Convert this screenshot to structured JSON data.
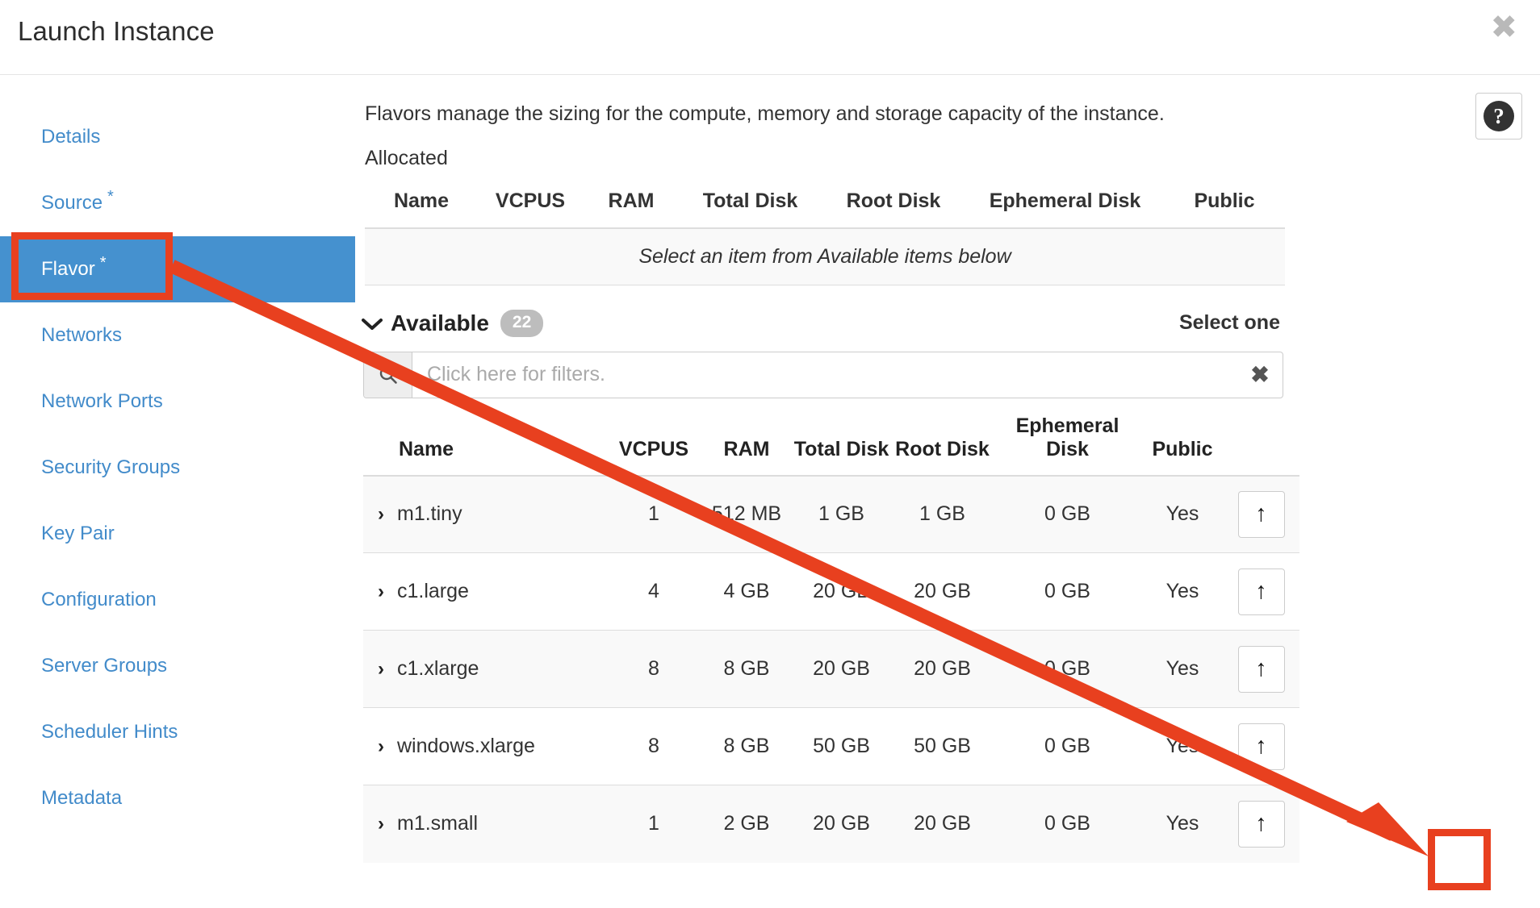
{
  "modal": {
    "title": "Launch Instance",
    "close_label": "✖"
  },
  "sidebar": {
    "items": [
      {
        "label": "Details",
        "required": "",
        "active": false
      },
      {
        "label": "Source",
        "required": "*",
        "active": false
      },
      {
        "label": "Flavor",
        "required": "*",
        "active": true
      },
      {
        "label": "Networks",
        "required": "",
        "active": false
      },
      {
        "label": "Network Ports",
        "required": "",
        "active": false
      },
      {
        "label": "Security Groups",
        "required": "",
        "active": false
      },
      {
        "label": "Key Pair",
        "required": "",
        "active": false
      },
      {
        "label": "Configuration",
        "required": "",
        "active": false
      },
      {
        "label": "Server Groups",
        "required": "",
        "active": false
      },
      {
        "label": "Scheduler Hints",
        "required": "",
        "active": false
      },
      {
        "label": "Metadata",
        "required": "",
        "active": false
      }
    ]
  },
  "main": {
    "intro": "Flavors manage the sizing for the compute, memory and storage capacity of the instance.",
    "help_glyph": "?",
    "allocated": {
      "label": "Allocated",
      "columns": [
        "Name",
        "VCPUS",
        "RAM",
        "Total Disk",
        "Root Disk",
        "Ephemeral Disk",
        "Public"
      ],
      "empty_message": "Select an item from Available items below",
      "rows": []
    },
    "available": {
      "label": "Available",
      "count": "22",
      "chevron": "⌄",
      "select_mode_label": "Select one",
      "filter": {
        "placeholder": "Click here for filters.",
        "value": "",
        "clear_glyph": "✖",
        "search_glyph": "⚲"
      },
      "columns": [
        "Name",
        "VCPUS",
        "RAM",
        "Total Disk",
        "Root Disk",
        "Ephemeral Disk",
        "Public",
        ""
      ],
      "row_expand_glyph": "›",
      "row_action_glyph": "↑",
      "rows": [
        {
          "name": "m1.tiny",
          "vcpus": "1",
          "ram": "512 MB",
          "total_disk": "1 GB",
          "root_disk": "1 GB",
          "ephemeral_disk": "0 GB",
          "public": "Yes"
        },
        {
          "name": "c1.large",
          "vcpus": "4",
          "ram": "4 GB",
          "total_disk": "20 GB",
          "root_disk": "20 GB",
          "ephemeral_disk": "0 GB",
          "public": "Yes"
        },
        {
          "name": "c1.xlarge",
          "vcpus": "8",
          "ram": "8 GB",
          "total_disk": "20 GB",
          "root_disk": "20 GB",
          "ephemeral_disk": "0 GB",
          "public": "Yes"
        },
        {
          "name": "windows.xlarge",
          "vcpus": "8",
          "ram": "8 GB",
          "total_disk": "50 GB",
          "root_disk": "50 GB",
          "ephemeral_disk": "0 GB",
          "public": "Yes"
        },
        {
          "name": "m1.small",
          "vcpus": "1",
          "ram": "2 GB",
          "total_disk": "20 GB",
          "root_disk": "20 GB",
          "ephemeral_disk": "0 GB",
          "public": "Yes"
        }
      ]
    }
  },
  "annotations": {
    "color": "#e8401f",
    "highlight_flavor_tab": true,
    "highlight_allocate_button": true,
    "arrow_from": "flavor-tab",
    "arrow_to": "allocate-button-row-5"
  },
  "colors": {
    "accent_link": "#428bca",
    "active_tab_bg": "#4591cf",
    "annotation_red": "#e8401f",
    "row_alt_bg": "#f9f9f9",
    "border": "#dddddd"
  }
}
